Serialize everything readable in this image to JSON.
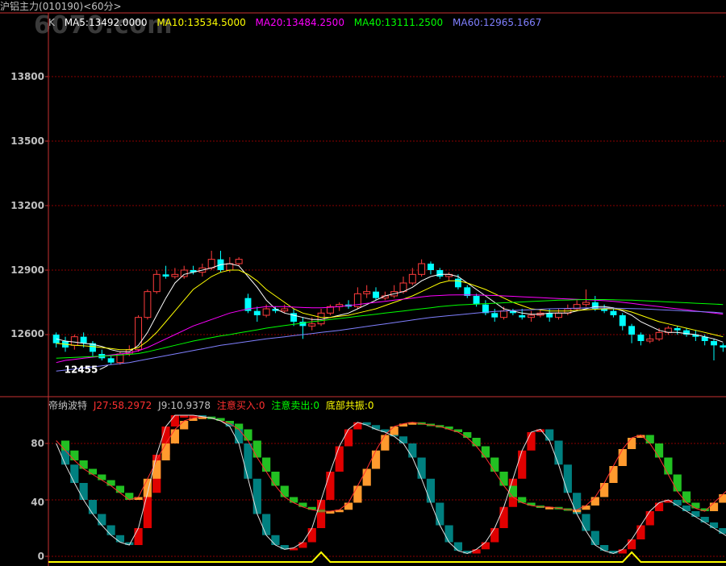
{
  "header": {
    "instrument_name": "沪铝主力",
    "instrument_code": "(010190)<60分>",
    "watermark": "6070.com"
  },
  "main_panel": {
    "k_label": "K",
    "ma_legend": [
      {
        "label": "MA5:13492.0000",
        "color": "#ffffff"
      },
      {
        "label": "MA10:13534.5000",
        "color": "#ffff00"
      },
      {
        "label": "MA20:13484.2500",
        "color": "#ff00ff"
      },
      {
        "label": "MA40:13111.2500",
        "color": "#00ff00"
      },
      {
        "label": "MA60:12965.1667",
        "color": "#8080ff"
      }
    ],
    "y_ticks": [
      "13800",
      "13500",
      "13200",
      "12900",
      "12600"
    ],
    "low_marker": "12455"
  },
  "sub_panel": {
    "indicator_name": "帝纳波特",
    "legend": [
      {
        "label": "J27:58.2972",
        "color": "#ff3030"
      },
      {
        "label": "J9:10.9378",
        "color": "#c0c0c0"
      },
      {
        "label": "注意买入:0",
        "color": "#ff3030"
      },
      {
        "label": "注意卖出:0",
        "color": "#00ff00"
      },
      {
        "label": "底部共振:0",
        "color": "#ffff00"
      }
    ],
    "y_ticks": [
      "80",
      "40",
      "0"
    ]
  },
  "colors": {
    "up": "#ff3c3c",
    "down": "#00ffff",
    "grid": "#8b0000",
    "border": "#c83232"
  },
  "chart_data": {
    "type": "candlestick",
    "price_ticks": [
      13800,
      13500,
      13200,
      12900,
      12600
    ],
    "price_range": [
      12430,
      14050
    ],
    "candles": [
      [
        12600,
        12560,
        12610,
        12540
      ],
      [
        12570,
        12540,
        12590,
        12520
      ],
      [
        12550,
        12590,
        12600,
        12530
      ],
      [
        12590,
        12560,
        12610,
        12540
      ],
      [
        12560,
        12520,
        12570,
        12500
      ],
      [
        12510,
        12490,
        12530,
        12480
      ],
      [
        12490,
        12470,
        12500,
        12460
      ],
      [
        12470,
        12510,
        12520,
        12460
      ],
      [
        12510,
        12530,
        12550,
        12500
      ],
      [
        12530,
        12680,
        12690,
        12520
      ],
      [
        12680,
        12800,
        12810,
        12670
      ],
      [
        12800,
        12880,
        12900,
        12790
      ],
      [
        12880,
        12870,
        12920,
        12860
      ],
      [
        12870,
        12880,
        12910,
        12860
      ],
      [
        12870,
        12900,
        12920,
        12860
      ],
      [
        12900,
        12890,
        12920,
        12880
      ],
      [
        12890,
        12910,
        12930,
        12870
      ],
      [
        12910,
        12950,
        12990,
        12900
      ],
      [
        12950,
        12900,
        12990,
        12890
      ],
      [
        12900,
        12930,
        12960,
        12890
      ],
      [
        12930,
        12950,
        12960,
        12920
      ],
      [
        12770,
        12710,
        12790,
        12700
      ],
      [
        12710,
        12690,
        12730,
        12660
      ],
      [
        12690,
        12720,
        12740,
        12680
      ],
      [
        12720,
        12710,
        12730,
        12700
      ],
      [
        12710,
        12720,
        12740,
        12700
      ],
      [
        12700,
        12660,
        12720,
        12640
      ],
      [
        12660,
        12640,
        12680,
        12580
      ],
      [
        12640,
        12650,
        12680,
        12620
      ],
      [
        12650,
        12700,
        12720,
        12640
      ],
      [
        12700,
        12730,
        12740,
        12690
      ],
      [
        12730,
        12740,
        12750,
        12710
      ],
      [
        12740,
        12730,
        12760,
        12720
      ],
      [
        12730,
        12790,
        12820,
        12720
      ],
      [
        12790,
        12800,
        12830,
        12770
      ],
      [
        12800,
        12770,
        12820,
        12760
      ],
      [
        12770,
        12780,
        12800,
        12760
      ],
      [
        12780,
        12800,
        12830,
        12770
      ],
      [
        12800,
        12840,
        12870,
        12790
      ],
      [
        12840,
        12880,
        12910,
        12830
      ],
      [
        12880,
        12930,
        12950,
        12870
      ],
      [
        12930,
        12900,
        12940,
        12880
      ],
      [
        12900,
        12870,
        12910,
        12860
      ],
      [
        12870,
        12880,
        12890,
        12850
      ],
      [
        12860,
        12820,
        12880,
        12810
      ],
      [
        12820,
        12780,
        12830,
        12770
      ],
      [
        12780,
        12740,
        12790,
        12730
      ],
      [
        12740,
        12700,
        12760,
        12690
      ],
      [
        12700,
        12680,
        12720,
        12660
      ],
      [
        12680,
        12710,
        12730,
        12670
      ],
      [
        12710,
        12700,
        12720,
        12690
      ],
      [
        12690,
        12680,
        12720,
        12670
      ],
      [
        12680,
        12690,
        12710,
        12660
      ],
      [
        12690,
        12700,
        12720,
        12680
      ],
      [
        12700,
        12680,
        12720,
        12660
      ],
      [
        12680,
        12700,
        12720,
        12670
      ],
      [
        12700,
        12720,
        12740,
        12690
      ],
      [
        12720,
        12740,
        12760,
        12710
      ],
      [
        12740,
        12750,
        12810,
        12730
      ],
      [
        12750,
        12720,
        12780,
        12710
      ],
      [
        12720,
        12710,
        12740,
        12700
      ],
      [
        12710,
        12690,
        12720,
        12680
      ],
      [
        12690,
        12640,
        12700,
        12620
      ],
      [
        12640,
        12600,
        12650,
        12560
      ],
      [
        12600,
        12570,
        12610,
        12550
      ],
      [
        12570,
        12580,
        12600,
        12560
      ],
      [
        12580,
        12610,
        12630,
        12570
      ],
      [
        12610,
        12630,
        12640,
        12600
      ],
      [
        12630,
        12620,
        12640,
        12600
      ],
      [
        12620,
        12600,
        12630,
        12590
      ],
      [
        12600,
        12590,
        12620,
        12570
      ],
      [
        12590,
        12570,
        12600,
        12550
      ],
      [
        12570,
        12550,
        12580,
        12480
      ],
      [
        12550,
        12540,
        12560,
        12520
      ]
    ],
    "ma_lines": {
      "MA5": [
        12580,
        12570,
        12565,
        12560,
        12555,
        12545,
        12530,
        12520,
        12520,
        12550,
        12610,
        12690,
        12770,
        12840,
        12880,
        12890,
        12900,
        12910,
        12925,
        12930,
        12920,
        12870,
        12820,
        12760,
        12720,
        12700,
        12690,
        12680,
        12670,
        12670,
        12680,
        12690,
        12700,
        12720,
        12740,
        12760,
        12780,
        12790,
        12800,
        12820,
        12850,
        12870,
        12880,
        12880,
        12870,
        12840,
        12810,
        12780,
        12750,
        12720,
        12710,
        12700,
        12695,
        12695,
        12700,
        12700,
        12700,
        12710,
        12720,
        12730,
        12730,
        12725,
        12710,
        12690,
        12660,
        12640,
        12620,
        12610,
        12610,
        12605,
        12600,
        12590,
        12580,
        12565
      ],
      "MA10": [
        12560,
        12555,
        12550,
        12548,
        12545,
        12540,
        12535,
        12530,
        12530,
        12540,
        12570,
        12610,
        12660,
        12710,
        12760,
        12810,
        12840,
        12870,
        12890,
        12900,
        12900,
        12880,
        12850,
        12810,
        12780,
        12750,
        12720,
        12700,
        12690,
        12680,
        12680,
        12685,
        12690,
        12700,
        12710,
        12720,
        12735,
        12750,
        12765,
        12780,
        12800,
        12820,
        12840,
        12850,
        12850,
        12840,
        12825,
        12810,
        12790,
        12770,
        12750,
        12735,
        12720,
        12715,
        12710,
        12710,
        12710,
        12712,
        12715,
        12718,
        12720,
        12720,
        12715,
        12705,
        12690,
        12675,
        12660,
        12650,
        12640,
        12630,
        12620,
        12610,
        12600,
        12590
      ],
      "MA20": [
        12470,
        12480,
        12485,
        12490,
        12495,
        12500,
        12505,
        12510,
        12515,
        12525,
        12540,
        12560,
        12580,
        12600,
        12620,
        12640,
        12655,
        12670,
        12685,
        12700,
        12710,
        12720,
        12725,
        12730,
        12730,
        12730,
        12728,
        12726,
        12725,
        12725,
        12727,
        12730,
        12735,
        12740,
        12745,
        12750,
        12755,
        12760,
        12765,
        12770,
        12775,
        12780,
        12782,
        12784,
        12785,
        12785,
        12784,
        12783,
        12782,
        12780,
        12778,
        12776,
        12774,
        12772,
        12770,
        12768,
        12766,
        12764,
        12762,
        12760,
        12758,
        12755,
        12750,
        12745,
        12740,
        12735,
        12730,
        12725,
        12720,
        12715,
        12710,
        12705,
        12700,
        12695
      ],
      "MA40": [
        12490,
        12492,
        12494,
        12496,
        12498,
        12500,
        12502,
        12505,
        12508,
        12512,
        12520,
        12530,
        12540,
        12550,
        12560,
        12570,
        12578,
        12586,
        12594,
        12600,
        12608,
        12615,
        12622,
        12630,
        12636,
        12642,
        12648,
        12654,
        12660,
        12665,
        12670,
        12675,
        12680,
        12685,
        12690,
        12695,
        12700,
        12705,
        12710,
        12715,
        12720,
        12725,
        12730,
        12734,
        12738,
        12740,
        12742,
        12744,
        12746,
        12748,
        12750,
        12752,
        12754,
        12756,
        12758,
        12760,
        12761,
        12762,
        12763,
        12763,
        12763,
        12762,
        12761,
        12760,
        12758,
        12756,
        12754,
        12752,
        12750,
        12748,
        12746,
        12744,
        12742,
        12740
      ],
      "MA60": [
        12430,
        12435,
        12440,
        12445,
        12450,
        12455,
        12460,
        12465,
        12470,
        12478,
        12486,
        12494,
        12502,
        12510,
        12518,
        12526,
        12534,
        12542,
        12550,
        12556,
        12562,
        12568,
        12574,
        12580,
        12585,
        12590,
        12595,
        12600,
        12605,
        12610,
        12615,
        12620,
        12626,
        12632,
        12638,
        12644,
        12650,
        12656,
        12662,
        12668,
        12674,
        12680,
        12684,
        12688,
        12692,
        12696,
        12700,
        12704,
        12708,
        12710,
        12712,
        12714,
        12716,
        12718,
        12720,
        12721,
        12722,
        12723,
        12724,
        12724,
        12724,
        12723,
        12722,
        12721,
        12720,
        12718,
        12716,
        12714,
        12712,
        12710,
        12708,
        12706,
        12704,
        12700
      ]
    },
    "indicator": {
      "range": [
        0,
        100
      ],
      "ticks": [
        80,
        40,
        0
      ],
      "J27": [
        82,
        75,
        68,
        62,
        58,
        54,
        50,
        45,
        40,
        42,
        55,
        68,
        80,
        90,
        96,
        98,
        99,
        98,
        96,
        94,
        90,
        82,
        70,
        60,
        50,
        42,
        38,
        35,
        33,
        32,
        32,
        33,
        38,
        50,
        62,
        75,
        86,
        92,
        94,
        95,
        94,
        93,
        92,
        90,
        88,
        84,
        78,
        70,
        60,
        50,
        42,
        38,
        36,
        35,
        35,
        34,
        33,
        33,
        36,
        42,
        52,
        64,
        76,
        84,
        86,
        80,
        70,
        58,
        46,
        38,
        34,
        32,
        38,
        44,
        50
      ],
      "J9": [
        80,
        65,
        52,
        40,
        30,
        22,
        15,
        10,
        8,
        20,
        45,
        72,
        92,
        100,
        100,
        100,
        99,
        98,
        96,
        92,
        80,
        55,
        30,
        15,
        8,
        5,
        6,
        10,
        20,
        40,
        60,
        78,
        90,
        95,
        93,
        90,
        88,
        85,
        80,
        70,
        55,
        38,
        22,
        10,
        4,
        2,
        5,
        10,
        20,
        35,
        55,
        75,
        88,
        90,
        82,
        65,
        45,
        30,
        18,
        8,
        4,
        2,
        5,
        12,
        22,
        32,
        38,
        40,
        36,
        32,
        28,
        24,
        20,
        16,
        12
      ],
      "bottom_resonance": [
        0,
        0,
        0,
        0,
        0,
        0,
        0,
        0,
        0,
        0,
        0,
        0,
        0,
        0,
        0,
        0,
        0,
        0,
        0,
        0,
        0,
        0,
        0,
        0,
        0,
        0,
        0,
        0,
        0,
        1,
        0,
        0,
        0,
        0,
        0,
        0,
        0,
        0,
        0,
        0,
        0,
        0,
        0,
        0,
        0,
        0,
        0,
        0,
        0,
        0,
        0,
        0,
        0,
        0,
        0,
        0,
        0,
        0,
        0,
        0,
        0,
        0,
        0,
        1,
        0,
        0,
        0,
        0,
        0,
        0,
        0,
        0,
        0,
        0
      ]
    }
  }
}
